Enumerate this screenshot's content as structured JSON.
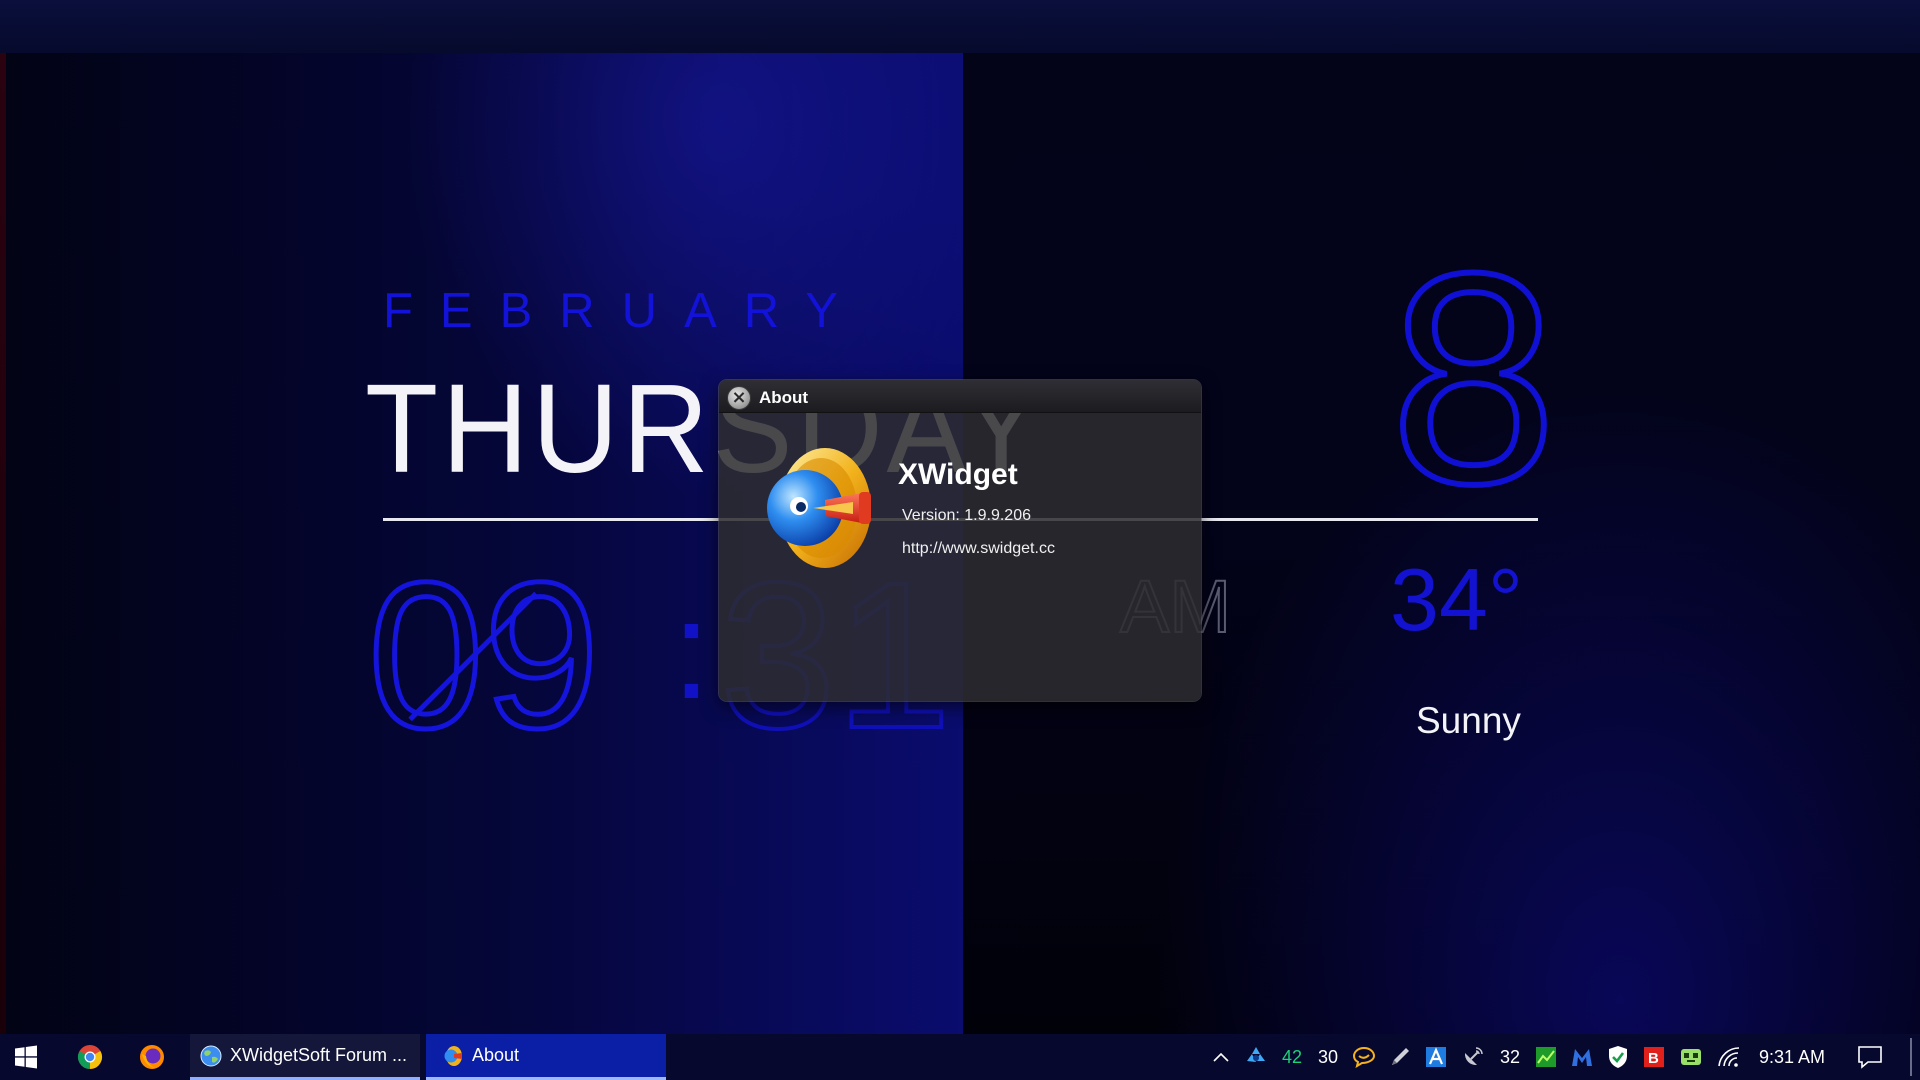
{
  "widget": {
    "month": "FEBRUARY",
    "weekday": "THURSDAY",
    "day": "8",
    "hour": "09",
    "minute": "31",
    "colon": ":",
    "ampm": "AM",
    "temperature": "34°",
    "condition": "Sunny"
  },
  "about_dialog": {
    "title": "About",
    "app_name": "XWidget",
    "version": "Version: 1.9.9.206",
    "url": "http://www.swidget.cc"
  },
  "taskbar": {
    "tasks": [
      {
        "label": "XWidgetSoft Forum ..."
      },
      {
        "label": "About"
      }
    ],
    "tray": {
      "value_1": "42",
      "value_2": "30",
      "value_3": "32",
      "clock": "9:31 AM"
    }
  },
  "colors": {
    "accent_blue": "#1212d8",
    "taskbar_bg": "#06082e",
    "active_task": "#0a1fa6",
    "tray_temp_green": "#1fcf7a"
  },
  "icons": {
    "start": "windows-logo-icon",
    "browser_1": "chrome-icon",
    "browser_2": "firefox-icon",
    "dialog_close": "close-icon",
    "app_logo": "xwidget-logo-icon"
  }
}
